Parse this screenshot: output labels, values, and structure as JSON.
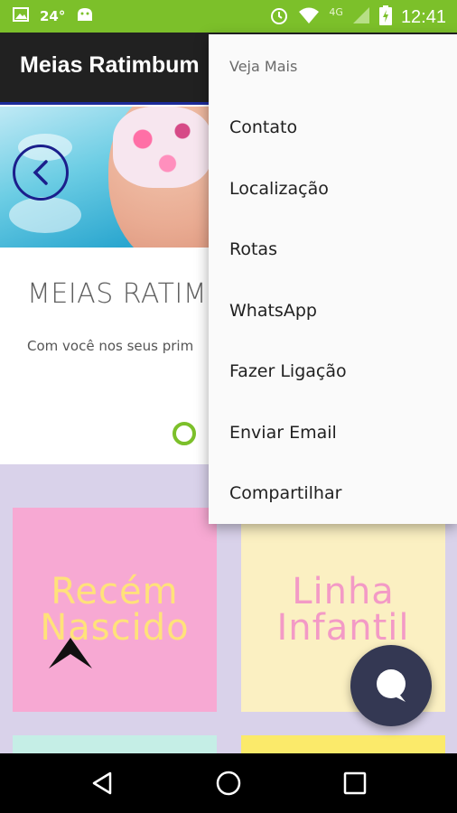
{
  "status_bar": {
    "temperature": "24°",
    "network": "4G",
    "time": "12:41",
    "icons": [
      "image-icon",
      "android-icon",
      "alarm-icon",
      "wifi-icon",
      "signal-icon",
      "battery-charging-icon"
    ]
  },
  "app_bar": {
    "title": "Meias Ratimbum"
  },
  "slider": {
    "title": "MEIAS RATIM",
    "text": "Com você nos seus prim"
  },
  "categories": [
    {
      "label": "Recém Nascido",
      "color": "#f7a9d3",
      "text_color": "#ffe27a"
    },
    {
      "label": "Linha Infantil",
      "color": "#fbf0c2",
      "text_color": "#f39ac6"
    }
  ],
  "menu": {
    "header": "Veja Mais",
    "items": [
      "Contato",
      "Localização",
      "Rotas",
      "WhatsApp",
      "Fazer Ligação",
      "Enviar Email",
      "Compartilhar"
    ]
  },
  "colors": {
    "status_bar": "#7cc02a",
    "app_bar": "#212121",
    "accent": "#1c2b9a",
    "fab": "#343853"
  }
}
